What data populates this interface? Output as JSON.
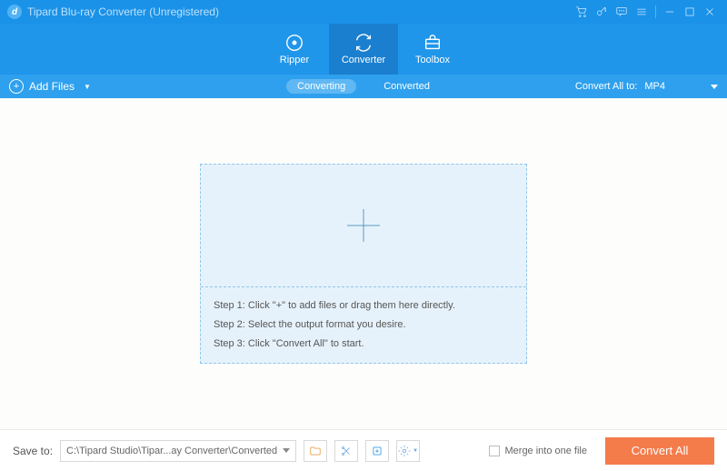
{
  "title": "Tipard Blu-ray Converter (Unregistered)",
  "nav": {
    "ripper": "Ripper",
    "converter": "Converter",
    "toolbox": "Toolbox"
  },
  "subbar": {
    "add_files": "Add Files",
    "converting": "Converting",
    "converted": "Converted",
    "convert_all_to": "Convert All to:",
    "format": "MP4"
  },
  "drop": {
    "step1": "Step 1: Click \"+\" to add files or drag them here directly.",
    "step2": "Step 2: Select the output format you desire.",
    "step3": "Step 3: Click \"Convert All\" to start."
  },
  "bottom": {
    "save_to": "Save to:",
    "path": "C:\\Tipard Studio\\Tipar...ay Converter\\Converted",
    "merge": "Merge into one file",
    "convert_all": "Convert All"
  }
}
